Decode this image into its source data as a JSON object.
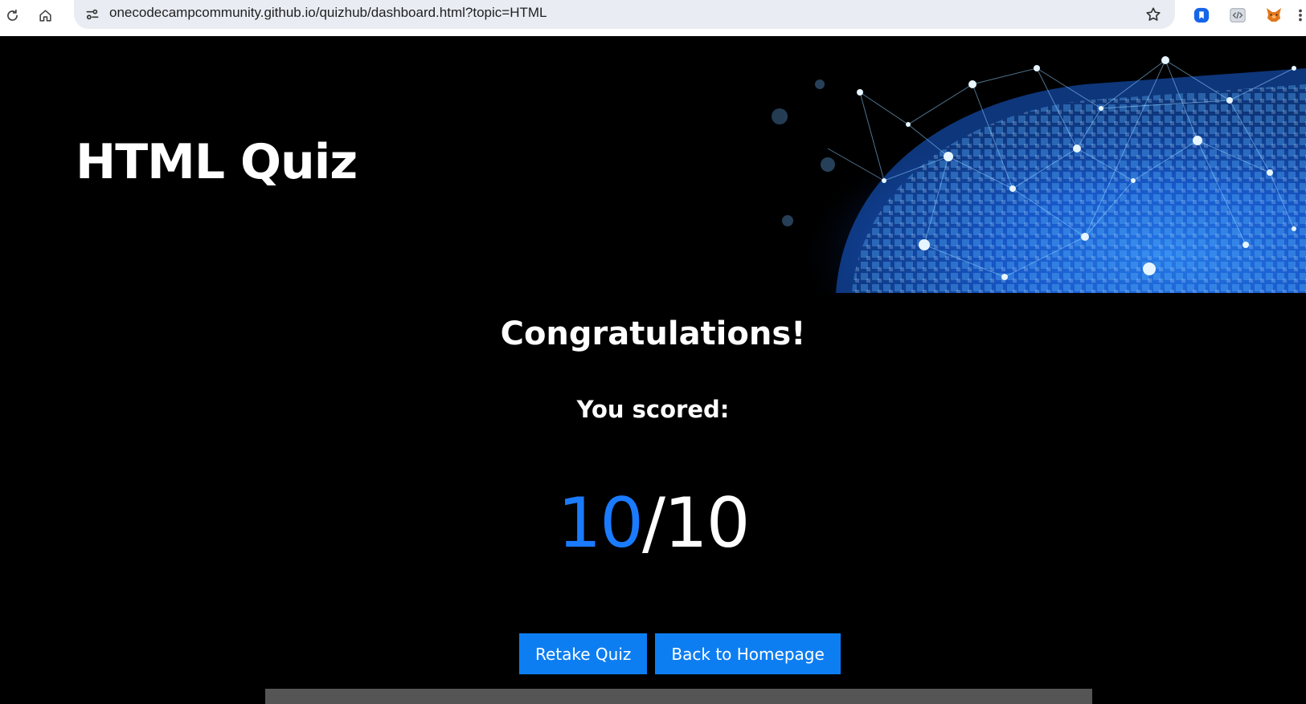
{
  "browser": {
    "url": "onecodecampcommunity.github.io/quizhub/dashboard.html?topic=HTML",
    "icons": [
      "reload-icon",
      "home-icon",
      "site-info-icon",
      "bookmark-star-icon",
      "extension-blue-icon",
      "extension-code-icon",
      "metamask-fox-icon"
    ]
  },
  "hero": {
    "title": "HTML Quiz"
  },
  "result": {
    "heading": "Congratulations!",
    "subheading": "You scored:",
    "score": "10",
    "separator": "/",
    "total": "10"
  },
  "actions": {
    "retake_label": "Retake Quiz",
    "home_label": "Back to Homepage"
  },
  "colors": {
    "accent": "#0d7ef2",
    "score_color": "#1a7bff",
    "background": "#000000"
  }
}
